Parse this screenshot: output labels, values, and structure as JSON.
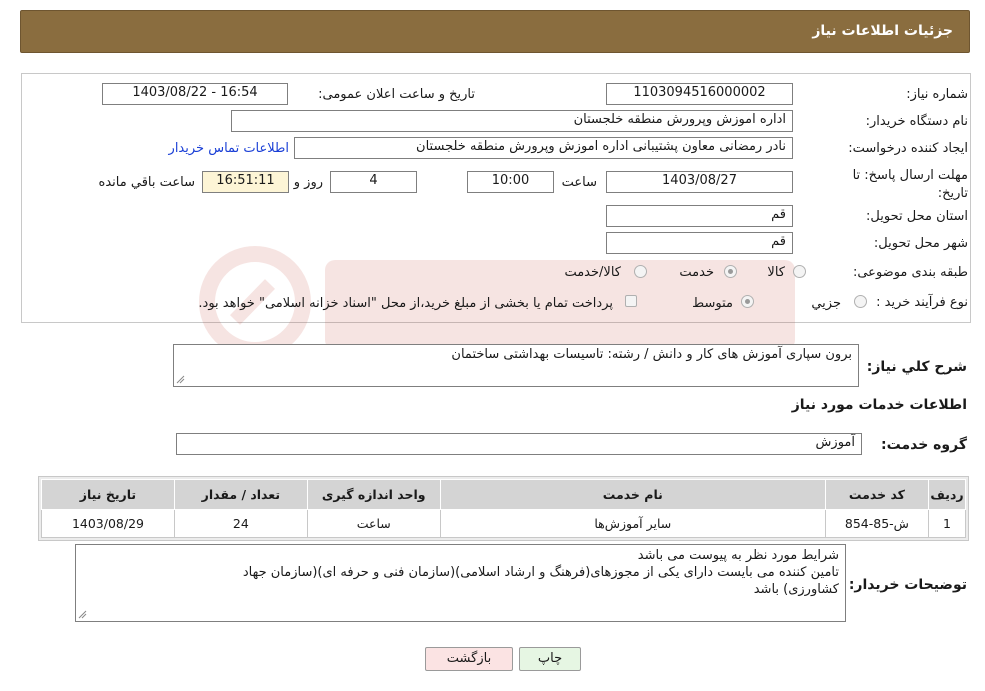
{
  "header": {
    "title": "جزئیات اطلاعات نیاز"
  },
  "form": {
    "need_number_label": "شماره نیاز:",
    "need_number": "1103094516000002",
    "announce_label": "تاریخ و ساعت اعلان عمومی:",
    "announce_value": "1403/08/22 - 16:54",
    "buyer_org_label": "نام دستگاه خریدار:",
    "buyer_org": "اداره اموزش وپرورش منطقه خلجستان",
    "creator_label": "ایجاد کننده درخواست:",
    "creator": "نادر رمضانی معاون پشتیبانی اداره اموزش وپرورش منطقه خلجستان",
    "contact_link": "اطلاعات تماس خریدار",
    "deadline_label": "مهلت ارسال پاسخ: تا تاریخ:",
    "deadline_date": "1403/08/27",
    "time_label": "ساعت",
    "deadline_time": "10:00",
    "days_value": "4",
    "days_label": "روز و",
    "remaining_time": "16:51:11",
    "remaining_label": "ساعت باقي مانده",
    "province_label": "استان محل تحویل:",
    "province": "قم",
    "city_label": "شهر محل تحویل:",
    "city": "قم",
    "category_label": "طبقه بندی موضوعی:",
    "category_options": [
      "کالا",
      "خدمت",
      "کالا/خدمت"
    ],
    "process_label": "نوع فرآیند خرید :",
    "process_options": [
      "جزيي",
      "متوسط"
    ],
    "payment_note": "پرداخت تمام یا بخشی از مبلغ خرید،از محل \"اسناد خزانه اسلامی\" خواهد بود."
  },
  "description": {
    "label": "شرح کلي نياز:",
    "text": "برون سپاری آموزش های کار و دانش       /  رشته: تاسیسات بهداشتی ساختمان"
  },
  "services": {
    "title": "اطلاعات خدمات مورد نیاز",
    "group_label": "گروه خدمت:",
    "group_value": "آموزش",
    "columns": [
      "ردیف",
      "کد خدمت",
      "نام خدمت",
      "واحد اندازه گیری",
      "تعداد / مقدار",
      "تاریخ نیاز"
    ],
    "rows": [
      {
        "index": "1",
        "code": "ش-85-854",
        "name": "سایر آموزش‌ها",
        "unit": "ساعت",
        "qty": "24",
        "date": "1403/08/29"
      }
    ]
  },
  "buyer_notes": {
    "label": "توضیحات خریدار:",
    "line1": "شرایط مورد نظر به پیوست می باشد",
    "line2": "تامین کننده می بایست دارای یکی از مجوزهای(فرهنگ و ارشاد اسلامی)(سازمان فنی و حرفه ای)(سازمان جهاد",
    "line3": "کشاورزی) باشد"
  },
  "buttons": {
    "print": "چاپ",
    "back": "بازگشت"
  },
  "colors": {
    "header_bg": "#8a6d3f",
    "link": "#1a3fd6",
    "back_button": "#fbe3e3",
    "print_button": "#e6f6e3"
  }
}
